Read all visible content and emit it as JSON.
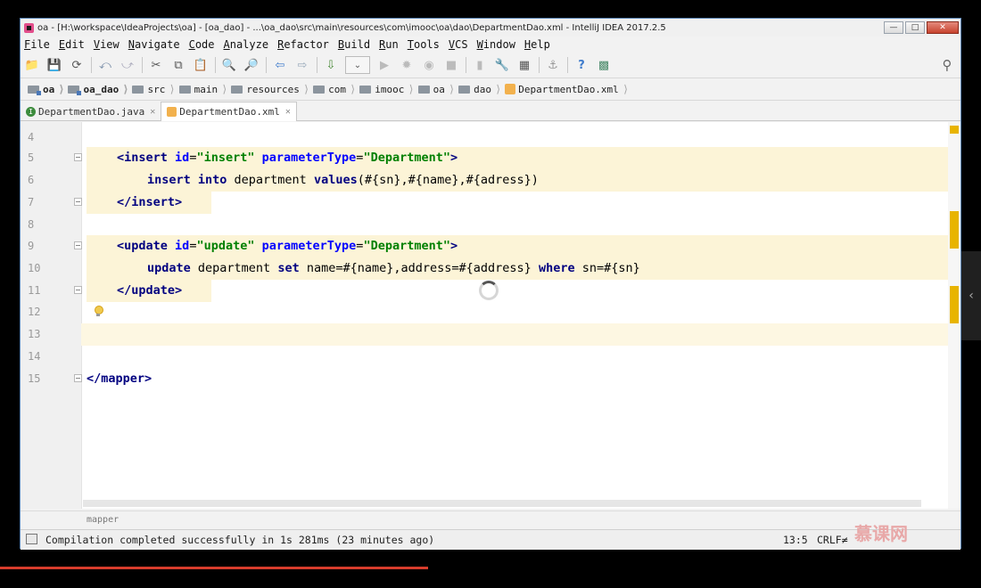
{
  "window": {
    "title": "oa - [H:\\workspace\\IdeaProjects\\oa] - [oa_dao] - ...\\oa_dao\\src\\main\\resources\\com\\imooc\\oa\\dao\\DepartmentDao.xml - IntelliJ IDEA 2017.2.5",
    "minimize": "—",
    "maximize": "□",
    "close": "✕"
  },
  "menu": [
    "File",
    "Edit",
    "View",
    "Navigate",
    "Code",
    "Analyze",
    "Refactor",
    "Build",
    "Run",
    "Tools",
    "VCS",
    "Window",
    "Help"
  ],
  "breadcrumb": [
    "oa",
    "oa_dao",
    "src",
    "main",
    "resources",
    "com",
    "imooc",
    "oa",
    "dao",
    "DepartmentDao.xml"
  ],
  "tabs": [
    {
      "label": "DepartmentDao.java",
      "icon": "I",
      "active": false
    },
    {
      "label": "DepartmentDao.xml",
      "icon": "x",
      "active": true
    }
  ],
  "editor": {
    "lines": [
      {
        "num": "4"
      },
      {
        "num": "5"
      },
      {
        "num": "6"
      },
      {
        "num": "7"
      },
      {
        "num": "8"
      },
      {
        "num": "9"
      },
      {
        "num": "10"
      },
      {
        "num": "11"
      },
      {
        "num": "12"
      },
      {
        "num": "13"
      },
      {
        "num": "14"
      },
      {
        "num": "15"
      }
    ],
    "code": {
      "insert_open": "<insert",
      "insert_id_attr": "id",
      "insert_id_val": "\"insert\"",
      "param_attr": "parameterType",
      "param_val": "\"Department\"",
      "insert_sql_kw1": "insert into",
      "insert_sql_rest": " department ",
      "insert_sql_kw2": "values",
      "insert_sql_vals": "(#{sn},#{name},#{adress})",
      "insert_close": "</insert>",
      "update_open": "<update",
      "update_id_val": "\"update\"",
      "update_sql_kw1": "update",
      "update_sql_mid": " department ",
      "update_sql_kw2": "set",
      "update_sql_rest": " name=#{name},address=#{address} ",
      "update_sql_kw3": "where",
      "update_sql_tail": " sn=#{sn}",
      "update_close": "</update>",
      "mapper_close": "</mapper>"
    }
  },
  "breadcrumb_bottom": "mapper",
  "status": {
    "message": "Compilation completed successfully in 1s 281ms (23 minutes ago)",
    "position": "13:5",
    "line_sep": "CRLF≠"
  },
  "watermark": "慕课网"
}
